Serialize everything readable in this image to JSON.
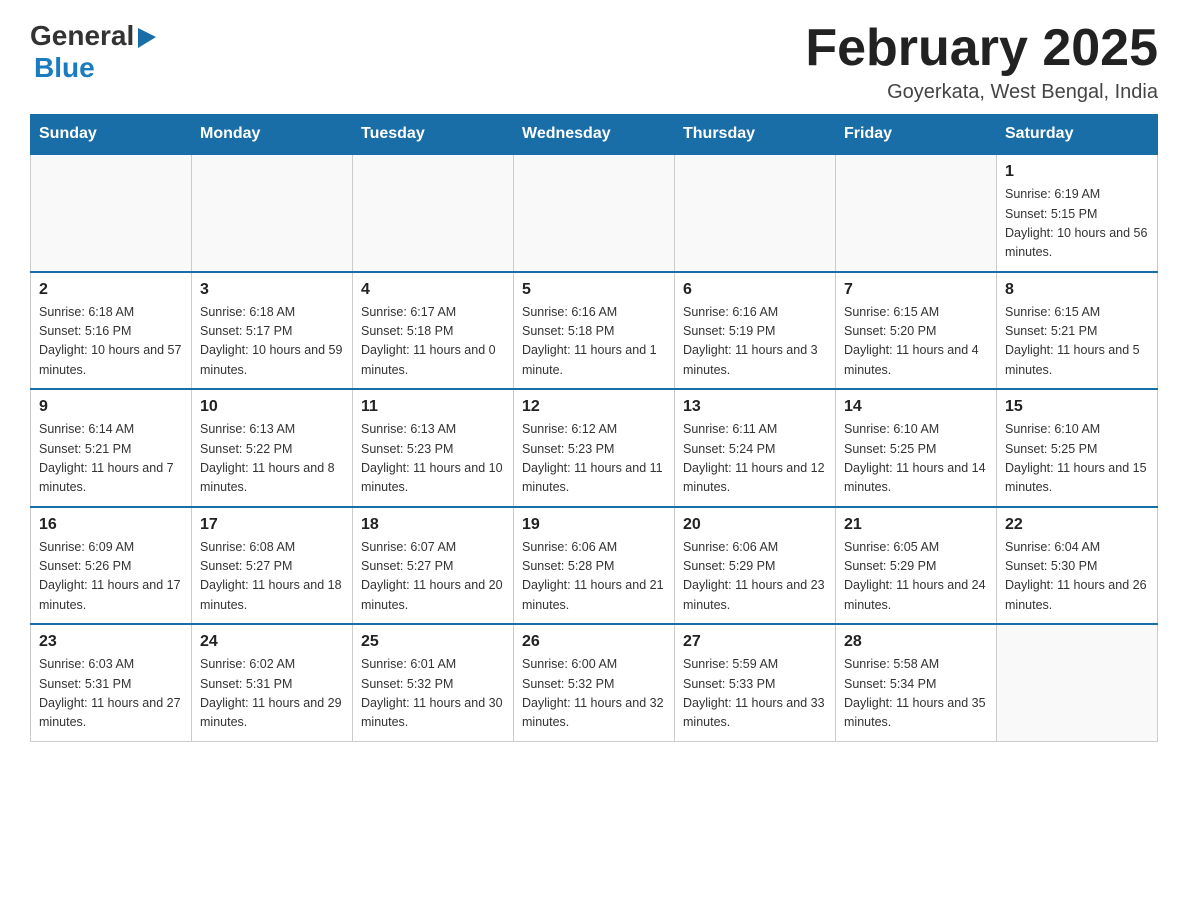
{
  "header": {
    "logo": {
      "text1": "General",
      "arrow": "▶",
      "text2": "Blue"
    },
    "title": "February 2025",
    "subtitle": "Goyerkata, West Bengal, India"
  },
  "weekdays": [
    "Sunday",
    "Monday",
    "Tuesday",
    "Wednesday",
    "Thursday",
    "Friday",
    "Saturday"
  ],
  "weeks": [
    [
      {
        "day": "",
        "info": ""
      },
      {
        "day": "",
        "info": ""
      },
      {
        "day": "",
        "info": ""
      },
      {
        "day": "",
        "info": ""
      },
      {
        "day": "",
        "info": ""
      },
      {
        "day": "",
        "info": ""
      },
      {
        "day": "1",
        "info": "Sunrise: 6:19 AM\nSunset: 5:15 PM\nDaylight: 10 hours and 56 minutes."
      }
    ],
    [
      {
        "day": "2",
        "info": "Sunrise: 6:18 AM\nSunset: 5:16 PM\nDaylight: 10 hours and 57 minutes."
      },
      {
        "day": "3",
        "info": "Sunrise: 6:18 AM\nSunset: 5:17 PM\nDaylight: 10 hours and 59 minutes."
      },
      {
        "day": "4",
        "info": "Sunrise: 6:17 AM\nSunset: 5:18 PM\nDaylight: 11 hours and 0 minutes."
      },
      {
        "day": "5",
        "info": "Sunrise: 6:16 AM\nSunset: 5:18 PM\nDaylight: 11 hours and 1 minute."
      },
      {
        "day": "6",
        "info": "Sunrise: 6:16 AM\nSunset: 5:19 PM\nDaylight: 11 hours and 3 minutes."
      },
      {
        "day": "7",
        "info": "Sunrise: 6:15 AM\nSunset: 5:20 PM\nDaylight: 11 hours and 4 minutes."
      },
      {
        "day": "8",
        "info": "Sunrise: 6:15 AM\nSunset: 5:21 PM\nDaylight: 11 hours and 5 minutes."
      }
    ],
    [
      {
        "day": "9",
        "info": "Sunrise: 6:14 AM\nSunset: 5:21 PM\nDaylight: 11 hours and 7 minutes."
      },
      {
        "day": "10",
        "info": "Sunrise: 6:13 AM\nSunset: 5:22 PM\nDaylight: 11 hours and 8 minutes."
      },
      {
        "day": "11",
        "info": "Sunrise: 6:13 AM\nSunset: 5:23 PM\nDaylight: 11 hours and 10 minutes."
      },
      {
        "day": "12",
        "info": "Sunrise: 6:12 AM\nSunset: 5:23 PM\nDaylight: 11 hours and 11 minutes."
      },
      {
        "day": "13",
        "info": "Sunrise: 6:11 AM\nSunset: 5:24 PM\nDaylight: 11 hours and 12 minutes."
      },
      {
        "day": "14",
        "info": "Sunrise: 6:10 AM\nSunset: 5:25 PM\nDaylight: 11 hours and 14 minutes."
      },
      {
        "day": "15",
        "info": "Sunrise: 6:10 AM\nSunset: 5:25 PM\nDaylight: 11 hours and 15 minutes."
      }
    ],
    [
      {
        "day": "16",
        "info": "Sunrise: 6:09 AM\nSunset: 5:26 PM\nDaylight: 11 hours and 17 minutes."
      },
      {
        "day": "17",
        "info": "Sunrise: 6:08 AM\nSunset: 5:27 PM\nDaylight: 11 hours and 18 minutes."
      },
      {
        "day": "18",
        "info": "Sunrise: 6:07 AM\nSunset: 5:27 PM\nDaylight: 11 hours and 20 minutes."
      },
      {
        "day": "19",
        "info": "Sunrise: 6:06 AM\nSunset: 5:28 PM\nDaylight: 11 hours and 21 minutes."
      },
      {
        "day": "20",
        "info": "Sunrise: 6:06 AM\nSunset: 5:29 PM\nDaylight: 11 hours and 23 minutes."
      },
      {
        "day": "21",
        "info": "Sunrise: 6:05 AM\nSunset: 5:29 PM\nDaylight: 11 hours and 24 minutes."
      },
      {
        "day": "22",
        "info": "Sunrise: 6:04 AM\nSunset: 5:30 PM\nDaylight: 11 hours and 26 minutes."
      }
    ],
    [
      {
        "day": "23",
        "info": "Sunrise: 6:03 AM\nSunset: 5:31 PM\nDaylight: 11 hours and 27 minutes."
      },
      {
        "day": "24",
        "info": "Sunrise: 6:02 AM\nSunset: 5:31 PM\nDaylight: 11 hours and 29 minutes."
      },
      {
        "day": "25",
        "info": "Sunrise: 6:01 AM\nSunset: 5:32 PM\nDaylight: 11 hours and 30 minutes."
      },
      {
        "day": "26",
        "info": "Sunrise: 6:00 AM\nSunset: 5:32 PM\nDaylight: 11 hours and 32 minutes."
      },
      {
        "day": "27",
        "info": "Sunrise: 5:59 AM\nSunset: 5:33 PM\nDaylight: 11 hours and 33 minutes."
      },
      {
        "day": "28",
        "info": "Sunrise: 5:58 AM\nSunset: 5:34 PM\nDaylight: 11 hours and 35 minutes."
      },
      {
        "day": "",
        "info": ""
      }
    ]
  ]
}
